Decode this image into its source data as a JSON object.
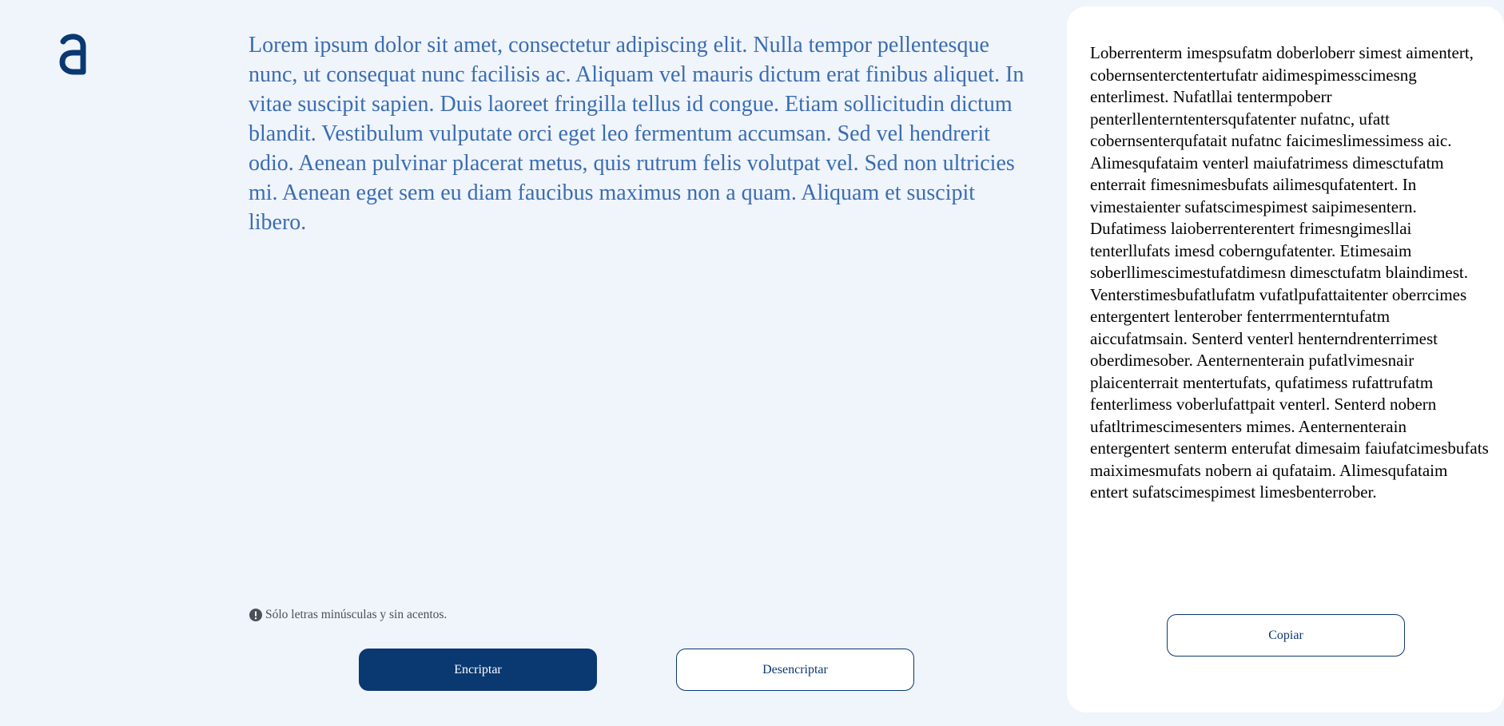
{
  "app": {
    "logo_icon": "alura-logo-icon",
    "accent_color": "#0a3871"
  },
  "input": {
    "text": "Lorem ipsum dolor sit amet, consectetur adipiscing elit. Nulla tempor pellentesque nunc, ut consequat nunc facilisis ac. Aliquam vel mauris dictum erat finibus aliquet. In vitae suscipit sapien. Duis laoreet fringilla tellus id congue. Etiam sollicitudin dictum blandit. Vestibulum vulputate orci eget leo fermentum accumsan. Sed vel hendrerit odio. Aenean pulvinar placerat metus, quis rutrum felis volutpat vel. Sed non ultricies mi. Aenean eget sem eu diam faucibus maximus non a quam. Aliquam et suscipit libero."
  },
  "warning": {
    "icon": "exclamation-circle-icon",
    "text": "Sólo letras minúsculas y sin acentos."
  },
  "buttons": {
    "encrypt_label": "Encriptar",
    "decrypt_label": "Desencriptar",
    "copy_label": "Copiar"
  },
  "output": {
    "text": "Loberrenterm imespsufatm doberloberr simest aimentert, cobernsenterctentertufatr aidimespimesscimesng enterlimest. Nufatllai tentermpoberr penterllenterntentersqufatenter nufatnc, ufatt cobernsenterqufatait nufatnc faicimeslimessimess aic. Alimesqufataim venterl maiufatrimess dimesctufatm enterrait fimesnimesbufats ailimesqufatentert. In vimestaienter sufatscimespimest saipimesentern. Dufatimess laioberrenterentert frimesngimesllai tenterllufats imesd coberngufatenter. Etimesaim soberllimescimestufatdimesn dimesctufatm blaindimest. Venterstimesbufatlufatm vufatlpufattaitenter oberrcimes entergentert lenterober fenterrmenterntufatm aiccufatmsain. Senterd venterl henterndrenterrimest oberdimesober. Aenternenterain pufatlvimesnair plaicenterrait mentertufats, qufatimess rufattrufatm fenterlimess voberlufattpait venterl. Senterd nobern ufatltrimescimesenters mimes. Aenternenterain entergentert senterm enterufat dimesaim faiufatcimesbufats maiximesmufats nobern ai qufataim. Alimesqufataim entert sufatscimespimest limesbenterrober."
  }
}
